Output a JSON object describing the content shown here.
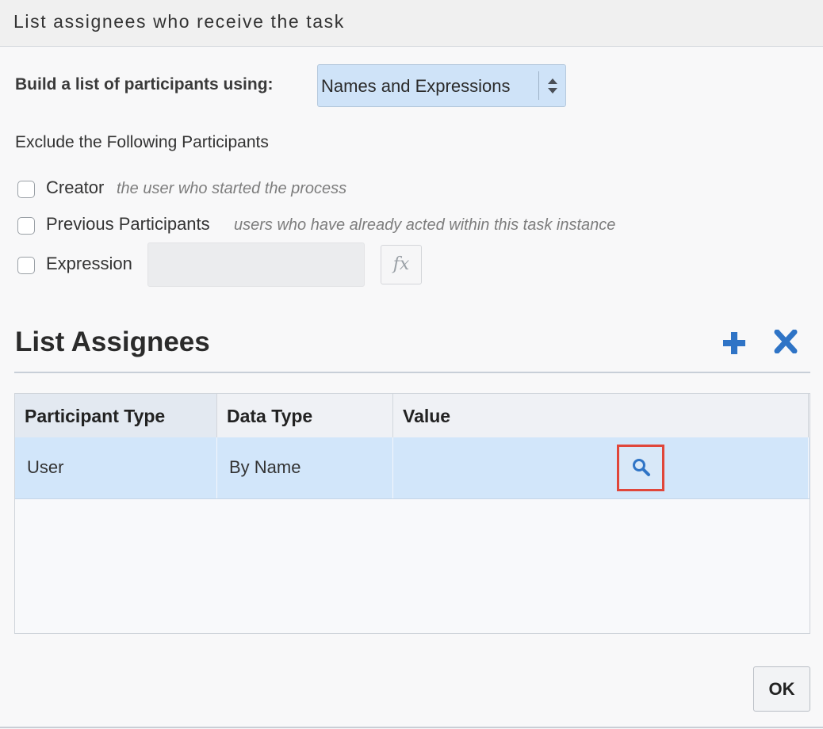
{
  "dialog": {
    "title": "List assignees who receive the task"
  },
  "build": {
    "label": "Build a list of participants using:",
    "selected": "Names and Expressions"
  },
  "exclude": {
    "heading": "Exclude the Following Participants",
    "options": [
      {
        "label": "Creator",
        "hint": "the user who started the process",
        "checked": false
      },
      {
        "label": "Previous Participants",
        "hint": "users who have already acted within this task instance",
        "checked": false
      },
      {
        "label": "Expression",
        "hint": "",
        "checked": false,
        "value": ""
      }
    ],
    "fx_label": "fx"
  },
  "assignees": {
    "title": "List Assignees",
    "add_icon": "plus-icon",
    "remove_icon": "x-icon",
    "accent_color": "#2f74c6",
    "columns": [
      "Participant Type",
      "Data Type",
      "Value"
    ],
    "rows": [
      {
        "participant_type": "User",
        "data_type": "By Name",
        "value": ""
      }
    ],
    "selected_row_color": "#d2e6fa",
    "highlight_color": "#e0463a"
  },
  "footer": {
    "ok_label": "OK"
  }
}
